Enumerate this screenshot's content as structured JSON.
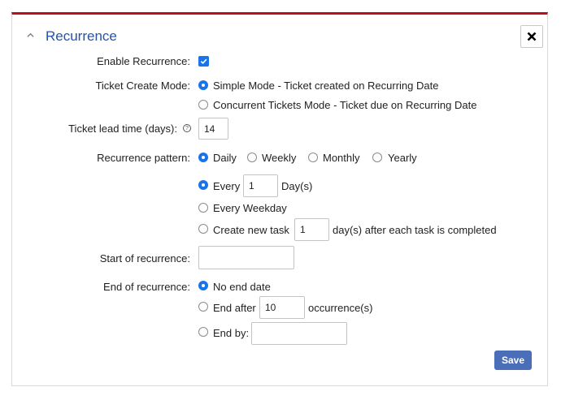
{
  "panel": {
    "title": "Recurrence",
    "save_label": "Save"
  },
  "enable_recurrence": {
    "label": "Enable Recurrence:",
    "checked": true
  },
  "ticket_create_mode": {
    "label": "Ticket Create Mode:",
    "options": [
      "Simple Mode - Ticket created on Recurring Date",
      "Concurrent Tickets Mode - Ticket due on Recurring Date"
    ],
    "selected": 0
  },
  "lead_time": {
    "label": "Ticket lead time (days):",
    "value": "14"
  },
  "pattern": {
    "label": "Recurrence pattern:",
    "options": [
      "Daily",
      "Weekly",
      "Monthly",
      "Yearly"
    ],
    "selected": 0
  },
  "daily": {
    "every_label": "Every",
    "every_value": "1",
    "days_label": "Day(s)",
    "weekday_label": "Every Weekday",
    "new_task_label": "Create new task",
    "new_task_value": "1",
    "new_task_suffix": "day(s) after each task is completed",
    "selected": 0
  },
  "start": {
    "label": "Start of recurrence:",
    "value": ""
  },
  "end": {
    "label": "End of recurrence:",
    "no_end_label": "No end date",
    "end_after_label": "End after",
    "end_after_value": "10",
    "occurrences_label": "occurrence(s)",
    "end_by_label": "End by:",
    "end_by_value": "",
    "selected": 0
  },
  "colors": {
    "accent": "#1a73e8",
    "title": "#2454a6",
    "top_border": "#b5121b",
    "save_button": "#4a6fb8"
  },
  "icons": {
    "collapse": "chevron-up-icon",
    "close": "close-icon",
    "help": "help-circle-icon",
    "check": "checkmark-icon"
  }
}
